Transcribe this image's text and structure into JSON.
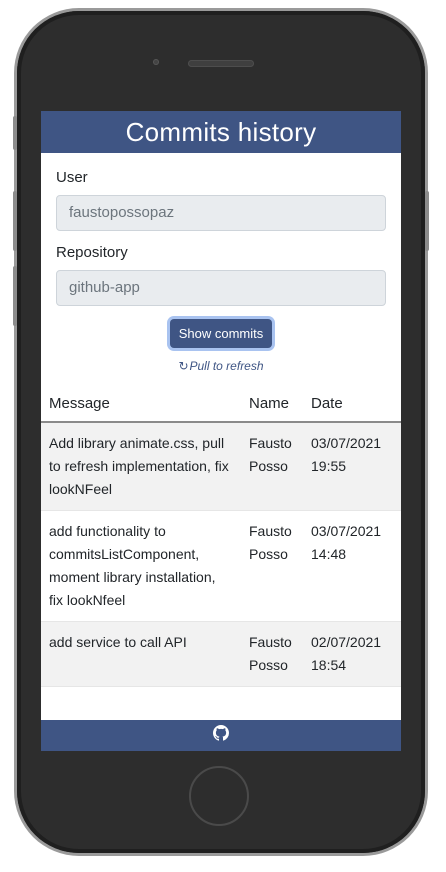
{
  "header": {
    "title": "Commits history"
  },
  "form": {
    "user_label": "User",
    "user_value": "faustopossopaz",
    "repo_label": "Repository",
    "repo_value": "github-app",
    "button_label": "Show commits",
    "refresh_text": "Pull to refresh",
    "refresh_icon": "↻"
  },
  "table": {
    "headers": [
      "Message",
      "Name",
      "Date"
    ],
    "rows": [
      {
        "message": "Add library animate.css, pull to refresh implementation, fix lookNFeel",
        "name": "Fausto Posso",
        "date": "03/07/2021 19:55"
      },
      {
        "message": "add functionality to commitsListComponent, moment library installation, fix lookNfeel",
        "name": "Fausto Posso",
        "date": "03/07/2021 14:48"
      },
      {
        "message": "add service to call API",
        "name": "Fausto Posso",
        "date": "02/07/2021 18:54"
      }
    ]
  },
  "footer": {
    "icon": "github-icon"
  },
  "colors": {
    "primary": "#3f5584",
    "button_focus_ring": "#a9c3f0",
    "input_bg": "#e9ecef",
    "phone_body": "#2d2d2d"
  }
}
